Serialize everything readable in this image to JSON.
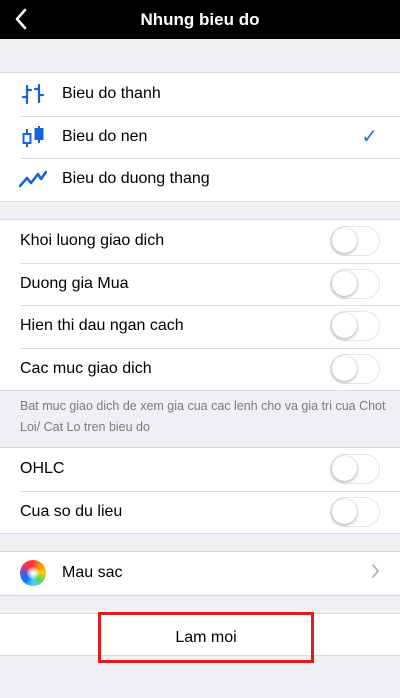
{
  "header": {
    "title": "Nhung bieu do"
  },
  "chart_types": [
    {
      "label": "Bieu do thanh",
      "icon": "bar-chart-icon",
      "selected": false
    },
    {
      "label": "Bieu do nen",
      "icon": "candlestick-chart-icon",
      "selected": true
    },
    {
      "label": "Bieu do duong thang",
      "icon": "line-chart-icon",
      "selected": false
    }
  ],
  "check_mark": "✓",
  "toggles_group1": [
    {
      "label": "Khoi luong giao dich",
      "on": false
    },
    {
      "label": "Duong gia Mua",
      "on": false
    },
    {
      "label": "Hien thi dau ngan cach",
      "on": false
    },
    {
      "label": "Cac muc giao dich",
      "on": false
    }
  ],
  "footnote": "Bat muc giao dich de xem gia cua cac lenh cho va gia tri cua Chot Loi/ Cat Lo tren bieu do",
  "toggles_group2": [
    {
      "label": "OHLC",
      "on": false
    },
    {
      "label": "Cua so du lieu",
      "on": false
    }
  ],
  "color_row": {
    "label": "Mau sac",
    "icon": "color-wheel-icon"
  },
  "reset_button": {
    "label": "Lam moi"
  },
  "colors": {
    "accent": "#1a73e8",
    "highlight_border": "#e01b1b",
    "icon_blue": "#1565d8"
  }
}
